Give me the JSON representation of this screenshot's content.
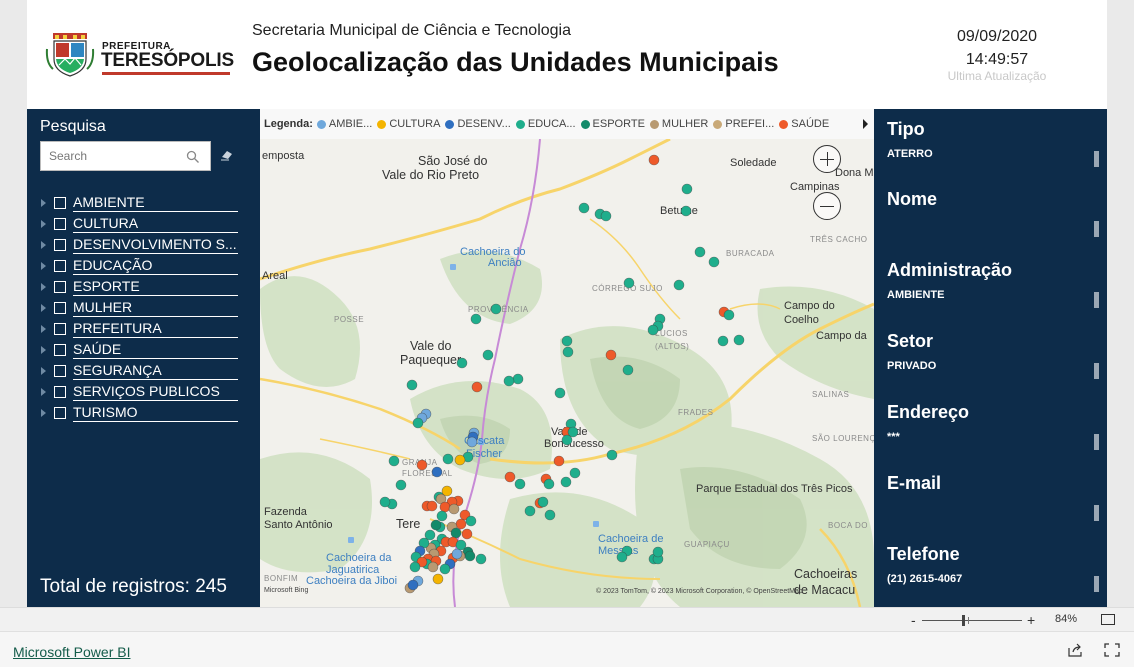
{
  "header": {
    "logo": {
      "pref": "PREFEITURA",
      "city": "TERESÓPOLIS"
    },
    "subtitle": "Secretaria Municipal de Ciência e Tecnologia",
    "title": "Geolocalização das Unidades Municipais",
    "date": "09/09/2020",
    "time": "14:49:57",
    "updated_label": "Ultima Atualização"
  },
  "left_panel": {
    "search_title": "Pesquisa",
    "search_placeholder": "Search",
    "categories": [
      "AMBIENTE",
      "CULTURA",
      "DESENVOLVIMENTO S...",
      "EDUCAÇÃO",
      "ESPORTE",
      "MULHER",
      "PREFEITURA",
      "SAÚDE",
      "SEGURANÇA",
      "SERVIÇOS PUBLICOS",
      "TURISMO"
    ],
    "total_label": "Total de registros: 245"
  },
  "map": {
    "legend_title": "Legenda:",
    "legend": [
      {
        "label": "AMBIE...",
        "color": "#6fa8dc"
      },
      {
        "label": "CULTURA",
        "color": "#f4b400"
      },
      {
        "label": "DESENV...",
        "color": "#2f6fc0"
      },
      {
        "label": "EDUCA...",
        "color": "#1fae8c"
      },
      {
        "label": "ESPORTE",
        "color": "#138a6a"
      },
      {
        "label": "MULHER",
        "color": "#b89a72"
      },
      {
        "label": "PREFEI...",
        "color": "#c9a978"
      },
      {
        "label": "SAÚDE",
        "color": "#ee5a2a"
      }
    ],
    "places": [
      {
        "text": "São José do",
        "big": true
      },
      {
        "text": "Vale do Rio Preto",
        "big": true
      },
      {
        "text": "Soledade",
        "big": false
      },
      {
        "text": "Dona M",
        "big": false
      },
      {
        "text": "Campinas",
        "big": false
      },
      {
        "text": "Betume",
        "big": false
      },
      {
        "text": "Cachoeira do",
        "big": false,
        "water": true
      },
      {
        "text": "Anciâo",
        "big": false,
        "water": true
      },
      {
        "text": "BURACADA",
        "big": false,
        "small": true
      },
      {
        "text": "TRÊS CACHO",
        "big": false,
        "small": true
      },
      {
        "text": "Areal",
        "big": false
      },
      {
        "text": "CÓRREGO SUJO",
        "big": false,
        "small": true
      },
      {
        "text": "PROVIDÊNCIA",
        "big": false,
        "small": true
      },
      {
        "text": "POSSE",
        "big": false,
        "small": true
      },
      {
        "text": "Campo do",
        "big": false
      },
      {
        "text": "Coelho",
        "big": false
      },
      {
        "text": "Campo da",
        "big": false
      },
      {
        "text": "LUCIOS",
        "big": false,
        "small": true
      },
      {
        "text": "(ALTOS)",
        "big": false,
        "small": true
      },
      {
        "text": "Vale do",
        "big": true
      },
      {
        "text": "Paquequer",
        "big": true
      },
      {
        "text": "SALINAS",
        "big": false,
        "small": true
      },
      {
        "text": "FRADES",
        "big": false,
        "small": true
      },
      {
        "text": "Cascata",
        "big": false,
        "water": true
      },
      {
        "text": "Fischer",
        "big": false,
        "water": true
      },
      {
        "text": "Vale de",
        "big": false
      },
      {
        "text": "Bonsucesso",
        "big": false
      },
      {
        "text": "SÃO LOURENÇ",
        "big": false,
        "small": true
      },
      {
        "text": "GRANJA",
        "big": false,
        "small": true
      },
      {
        "text": "FLORESTAL",
        "big": false,
        "small": true
      },
      {
        "text": "Parque Estadual dos Três Picos",
        "big": false
      },
      {
        "text": "Fazenda",
        "big": false
      },
      {
        "text": "Santo Antônio",
        "big": false
      },
      {
        "text": "Tere",
        "big": true
      },
      {
        "text": "BOCA DO",
        "big": false,
        "small": true
      },
      {
        "text": "Cachoeira de",
        "big": false,
        "water": true
      },
      {
        "text": "Messias",
        "big": false,
        "water": true
      },
      {
        "text": "GUAPIAÇU",
        "big": false,
        "small": true
      },
      {
        "text": "Cachoeira da",
        "big": false,
        "water": true
      },
      {
        "text": "Jaguatirica",
        "big": false,
        "water": true
      },
      {
        "text": "Cachoeira da Jiboi",
        "big": false,
        "water": true
      },
      {
        "text": "BONFIM",
        "big": false,
        "small": true
      },
      {
        "text": "Cachoeiras",
        "big": true
      },
      {
        "text": "de Macacu",
        "big": true
      },
      {
        "text": "empostа",
        "big": false
      }
    ],
    "copyright": "© 2023 TomTom, © 2023 Microsoft Corporation, © OpenStreetMap",
    "bing": "Microsoft Bing"
  },
  "right_panel": {
    "fields": [
      {
        "title": "Tipo",
        "value": "ATERRO"
      },
      {
        "title": "Nome",
        "value": ""
      },
      {
        "title": "Administração",
        "value": "AMBIENTE"
      },
      {
        "title": "Setor",
        "value": "PRIVADO"
      },
      {
        "title": "Endereço",
        "value": "***"
      },
      {
        "title": "E-mail",
        "value": ""
      },
      {
        "title": "Telefone",
        "value": "(21) 2615-4067"
      }
    ]
  },
  "footer": {
    "zoom_minus": "-",
    "zoom_plus": "+",
    "zoom_level": "84%",
    "link": "Microsoft Power BI"
  }
}
